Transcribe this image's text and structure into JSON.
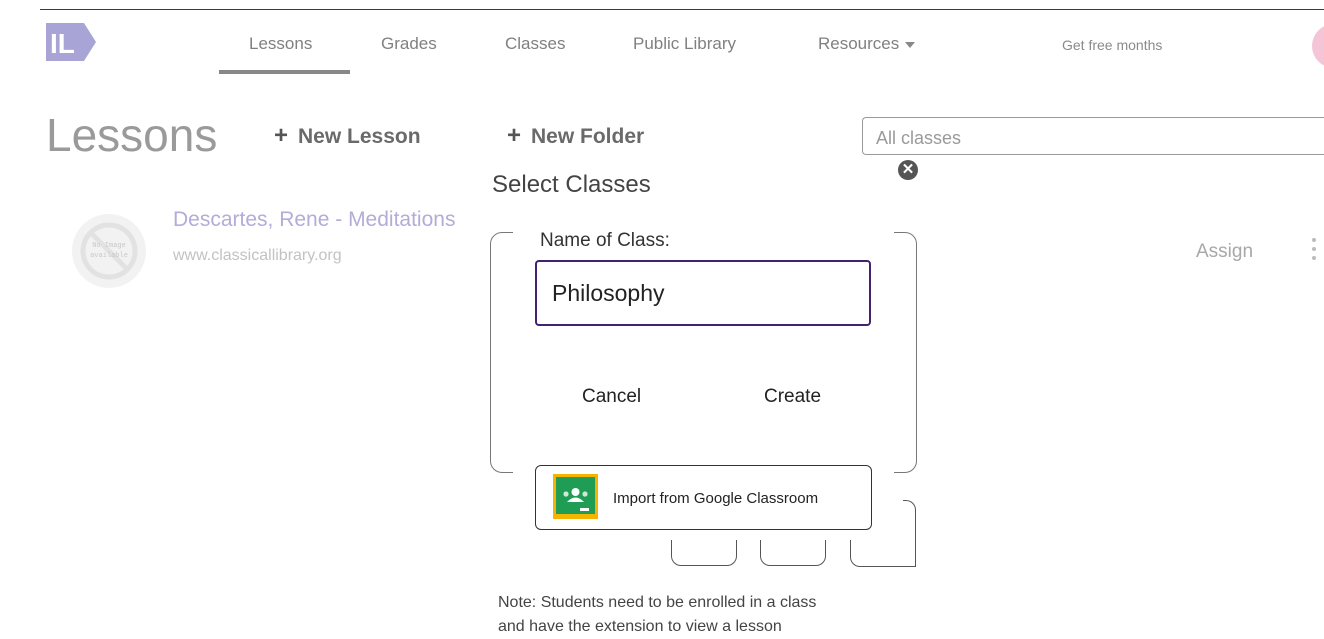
{
  "header": {
    "logo_text": "IL",
    "nav": [
      {
        "label": "Lessons"
      },
      {
        "label": "Grades"
      },
      {
        "label": "Classes"
      },
      {
        "label": "Public Library"
      },
      {
        "label": "Resources"
      }
    ],
    "get_free_months": "Get free months"
  },
  "toolbar": {
    "title": "Lessons",
    "new_lesson": "New Lesson",
    "new_folder": "New Folder",
    "class_filter": "All classes"
  },
  "lesson": {
    "title": "Descartes, Rene - Meditations",
    "url": "www.classicallibrary.org",
    "thumbnail_text": [
      "No Image",
      "available"
    ],
    "assign": "Assign"
  },
  "modal": {
    "title": "Select Classes",
    "field_label": "Name of Class:",
    "field_value": "Philosophy",
    "cancel": "Cancel",
    "create": "Create",
    "google_import": "Import from Google Classroom",
    "note_lines": [
      "Note: Students need to be enrolled in a class",
      "and have the extension to view a lesson"
    ]
  },
  "colors": {
    "accent": "#44226f",
    "logo": "#a8a4d6",
    "lesson_title": "#b3acd8",
    "google_green": "#1f9d55",
    "google_yellow": "#f4b400"
  }
}
